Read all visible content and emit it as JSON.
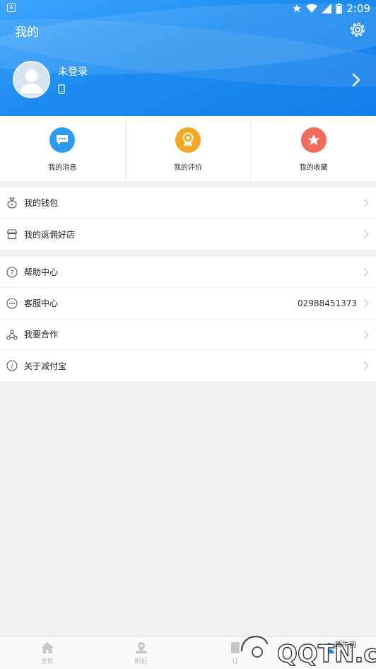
{
  "statusbar": {
    "time": "2:09",
    "notification_letter": "A"
  },
  "header": {
    "title": "我的"
  },
  "profile": {
    "login_text": "未登录"
  },
  "quick_actions": [
    {
      "label": "我的消息",
      "color": "#2d9cf0"
    },
    {
      "label": "我的评价",
      "color": "#f5a623"
    },
    {
      "label": "我的收藏",
      "color": "#f26b5b"
    }
  ],
  "menu_group1": [
    {
      "label": "我的钱包"
    },
    {
      "label": "我的返佣好店"
    }
  ],
  "menu_group2": [
    {
      "label": "帮助中心"
    },
    {
      "label": "客服中心",
      "value": "02988451373"
    },
    {
      "label": "我要合作"
    },
    {
      "label": "关于减付宝"
    }
  ],
  "bottom_nav": [
    {
      "label": "主页"
    },
    {
      "label": "附近"
    },
    {
      "label": "订"
    },
    {
      "label": ""
    }
  ],
  "watermark": {
    "text": "腾牛网",
    "logo_text": "QQTN.com"
  },
  "colors": {
    "accent": "#1d8cf0",
    "background": "#f1f1f1"
  }
}
